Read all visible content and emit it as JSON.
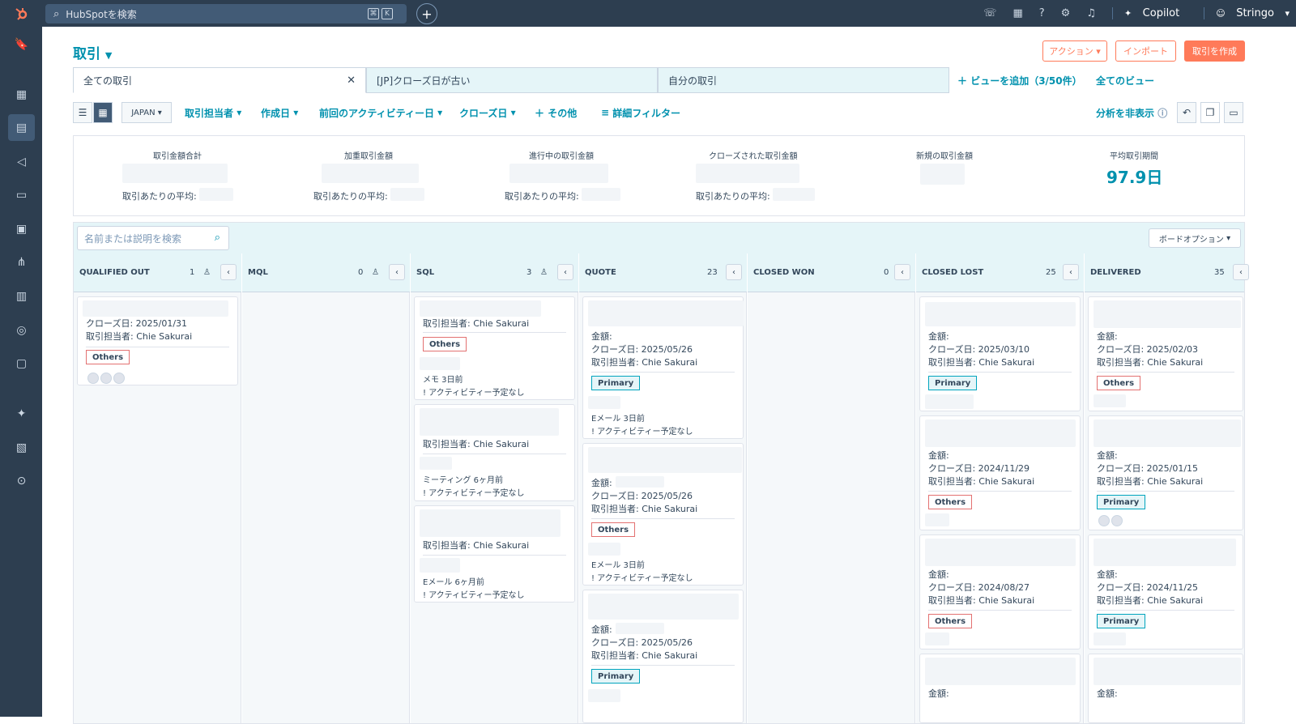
{
  "topbar": {
    "search_placeholder": "HubSpotを検索",
    "kbd1": "⌘",
    "kbd2": "K",
    "copilot": "Copilot",
    "account": "Stringo"
  },
  "header": {
    "title": "取引",
    "action": "アクション",
    "import": "インポート",
    "create": "取引を作成"
  },
  "tabs": [
    {
      "label": "全ての取引"
    },
    {
      "label": "[JP]クローズ日が古い"
    },
    {
      "label": "自分の取引"
    }
  ],
  "tabs_add": "ビューを追加（3/50件）",
  "tabs_all": "全てのビュー",
  "filters": {
    "region": "JAPAN",
    "owner": "取引担当者",
    "created": "作成日",
    "last_activity": "前回のアクティビティー日",
    "close_date": "クローズ日",
    "more": "その他",
    "advanced": "詳細フィルター",
    "hide_analysis": "分析を非表示"
  },
  "summary": {
    "total": "取引金額合計",
    "weighted": "加重取引金額",
    "open": "進行中の取引金額",
    "closed": "クローズされた取引金額",
    "new": "新規の取引金額",
    "avg_period": "平均取引期間",
    "avg_period_value": "97.9日",
    "avg_label": "取引あたりの平均:"
  },
  "board": {
    "search_placeholder": "名前または説明を検索",
    "options": "ボードオプション"
  },
  "columns": [
    {
      "name": "QUALIFIED OUT",
      "count": "1"
    },
    {
      "name": "MQL",
      "count": "0"
    },
    {
      "name": "SQL",
      "count": "3"
    },
    {
      "name": "QUOTE",
      "count": "23"
    },
    {
      "name": "CLOSED WON",
      "count": "0"
    },
    {
      "name": "CLOSED LOST",
      "count": "25"
    },
    {
      "name": "DELIVERED",
      "count": "35"
    }
  ],
  "cards": {
    "c_qo1_date": "クローズ日: 2025/01/31",
    "owner": "取引担当者: Chie Sakurai",
    "amount": "金額:",
    "others": "Others",
    "primary": "Primary",
    "sql1_memo": "メモ 3日前",
    "no_activity": "アクティビティー予定なし",
    "sql2_meet": "ミーティング 6ヶ月前",
    "sql3_email": "Eメール 6ヶ月前",
    "email_3d": "Eメール 3日前",
    "q_date": "クローズ日: 2025/05/26",
    "cl1_date": "クローズ日: 2025/03/10",
    "cl2_date": "クローズ日: 2024/11/29",
    "cl3_date": "クローズ日: 2024/08/27",
    "d1_date": "クローズ日: 2025/02/03",
    "d2_date": "クローズ日: 2025/01/15",
    "d3_date": "クローズ日: 2024/11/25"
  }
}
